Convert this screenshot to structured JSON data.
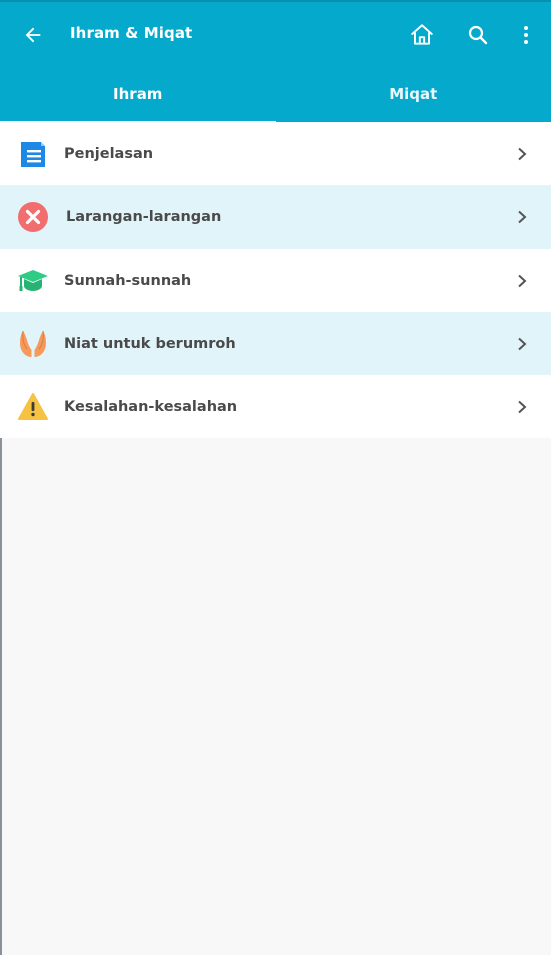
{
  "toolbar": {
    "title": "Ihram & Miqat",
    "back_icon": "arrow-left-icon",
    "home_icon": "home-icon",
    "search_icon": "search-icon",
    "more_icon": "more-vert-icon"
  },
  "tabs": [
    {
      "label": "Ihram",
      "active": true
    },
    {
      "label": "Miqat",
      "active": false
    }
  ],
  "items": [
    {
      "label": "Penjelasan",
      "icon": "document-icon"
    },
    {
      "label": "Larangan-larangan",
      "icon": "cancel-icon"
    },
    {
      "label": "Sunnah-sunnah",
      "icon": "graduation-cap-icon"
    },
    {
      "label": "Niat untuk berumroh",
      "icon": "praying-hands-icon"
    },
    {
      "label": "Kesalahan-kesalahan",
      "icon": "warning-icon"
    }
  ],
  "colors": {
    "appbar": "#04a9cc",
    "row_alt": "#e1f4fa",
    "background": "#f8f8f8"
  }
}
